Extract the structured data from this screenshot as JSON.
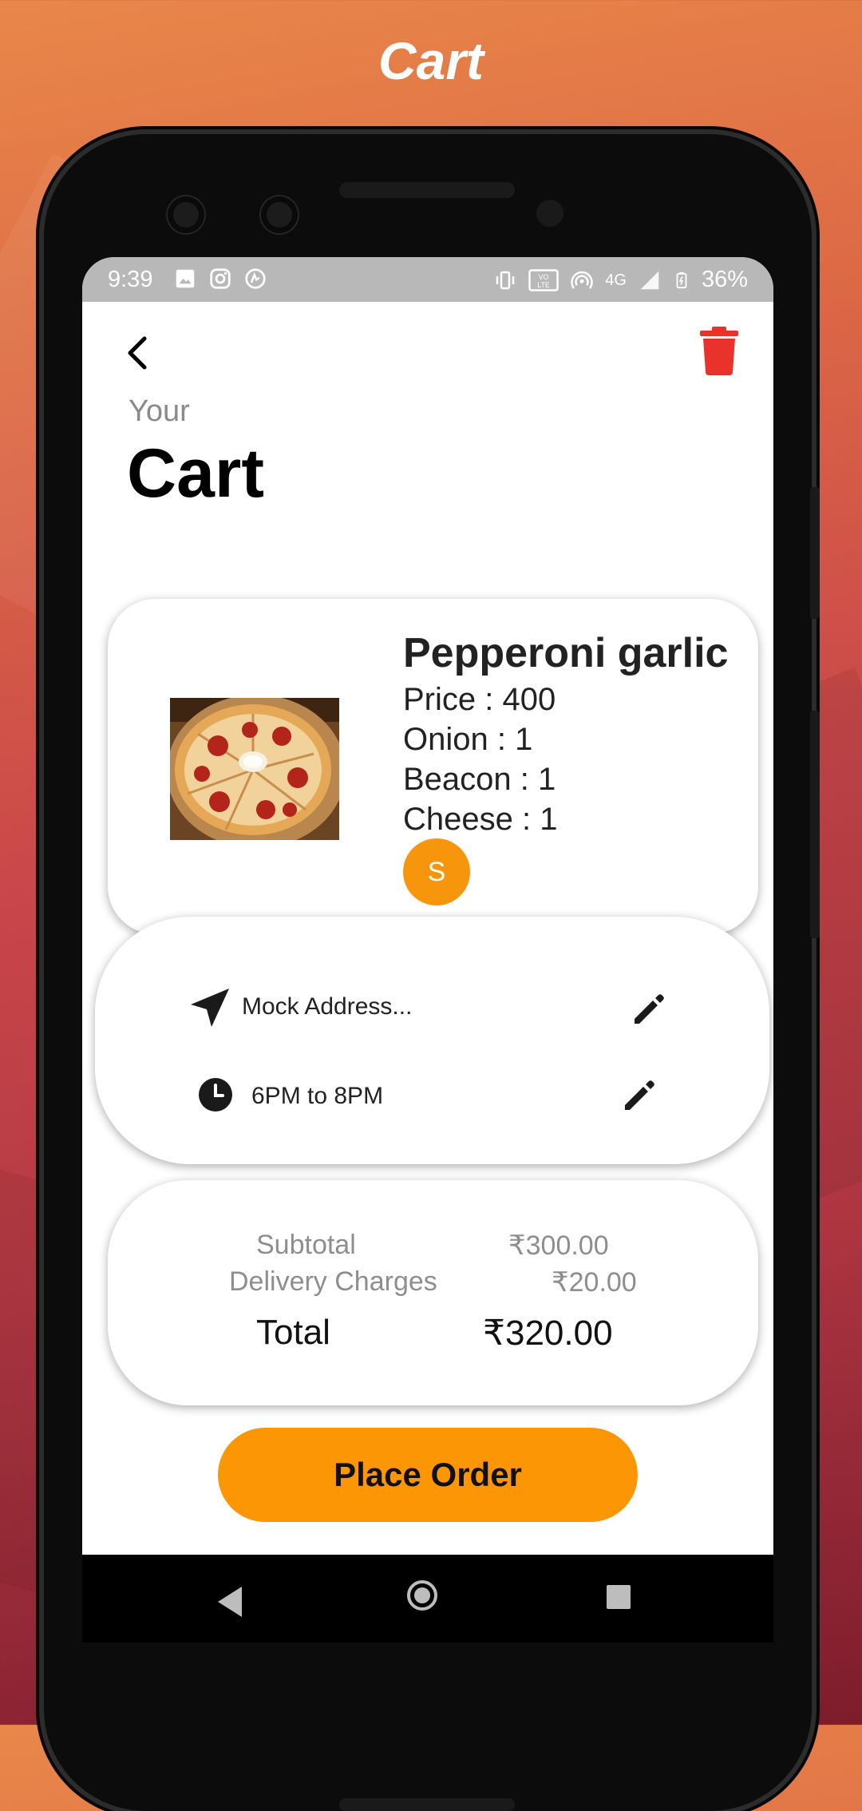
{
  "promo": {
    "title": "Cart"
  },
  "status_bar": {
    "time": "9:39",
    "network": "4G",
    "battery": "36%"
  },
  "header": {
    "subtitle": "Your",
    "title": "Cart"
  },
  "cart_item": {
    "name": "Pepperoni garlic",
    "price": "Price : 400",
    "options": [
      "Onion : 1",
      "Beacon : 1",
      "Cheese : 1"
    ],
    "badge": "S"
  },
  "delivery": {
    "address": "Mock Address...",
    "time_slot": "6PM to 8PM"
  },
  "summary": {
    "subtotal_label": "Subtotal",
    "subtotal_value": "₹300.00",
    "delivery_label": "Delivery Charges",
    "delivery_value": "₹20.00",
    "total_label": "Total",
    "total_value": "₹320.00"
  },
  "actions": {
    "place_order": "Place Order"
  },
  "colors": {
    "accent": "#fd9604",
    "delete": "#e8322b",
    "background_top": "#e9874a",
    "background_bottom": "#7d1c2c"
  },
  "icons": [
    "back-arrow-icon",
    "trash-icon",
    "navigation-arrow-icon",
    "edit-pencil-icon",
    "clock-icon"
  ]
}
